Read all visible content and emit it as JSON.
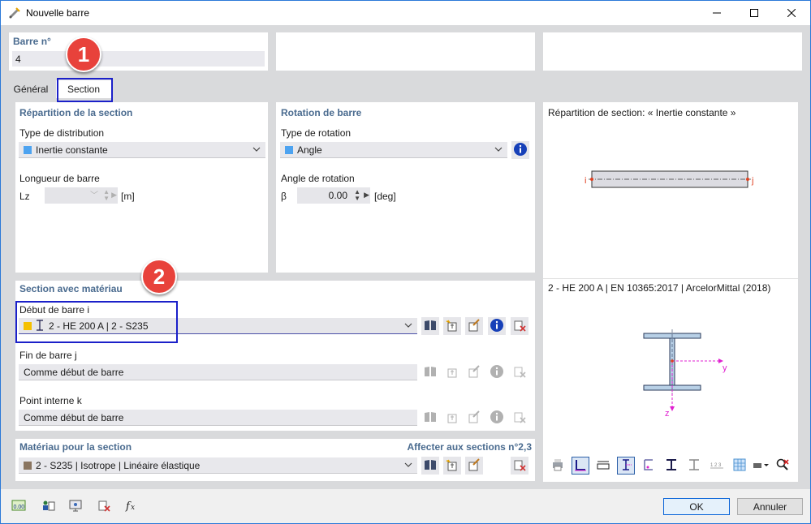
{
  "window": {
    "title": "Nouvelle barre",
    "minimize_icon": "minimize-icon",
    "maximize_icon": "maximize-icon",
    "close_icon": "close-icon"
  },
  "member": {
    "label": "Barre n°",
    "value": "4"
  },
  "tabs": [
    {
      "label": "Général"
    },
    {
      "label": "Section"
    }
  ],
  "section_distribution": {
    "title": "Répartition de la section",
    "type_label": "Type de distribution",
    "type_value": "Inertie constante",
    "type_color": "#4da3f0",
    "length_label": "Longueur de barre",
    "length_symbol": "Lz",
    "length_value": "",
    "length_unit": "[m]"
  },
  "rotation": {
    "title": "Rotation de barre",
    "type_label": "Type de rotation",
    "type_value": "Angle",
    "type_color": "#4da3f0",
    "angle_label": "Angle de rotation",
    "angle_symbol": "β",
    "angle_value": "0.00",
    "angle_unit": "[deg]"
  },
  "section_material": {
    "title": "Section avec matériau",
    "start_label": "Début de barre i",
    "start_value": "2 - HE 200 A | 2 - S235",
    "start_color": "#f5c000",
    "end_label": "Fin de barre j",
    "end_value": "Comme début de barre",
    "internal_label": "Point interne k",
    "internal_value": "Comme début de barre"
  },
  "material": {
    "title": "Matériau pour la section",
    "assign_text": "Affecter aux sections n°2,3",
    "value": "2 - S235 | Isotrope | Linéaire élastique",
    "color": "#8a7560"
  },
  "preview": {
    "distribution_title": "Répartition de section: « Inertie constante »",
    "node_i": "i",
    "node_j": "j",
    "section_title": "2 - HE 200 A | EN 10365:2017 | ArcelorMittal (2018)",
    "axis_y": "y",
    "axis_z": "z"
  },
  "annotations": {
    "badge_1": "1",
    "badge_2": "2"
  },
  "footer": {
    "ok": "OK",
    "cancel": "Annuler"
  },
  "colors": {
    "accent": "#2b79d8",
    "title_blue": "#4a6b8f",
    "badge_red": "#e8423b",
    "highlight": "#1b20c9",
    "axis_magenta": "#e020d0"
  }
}
